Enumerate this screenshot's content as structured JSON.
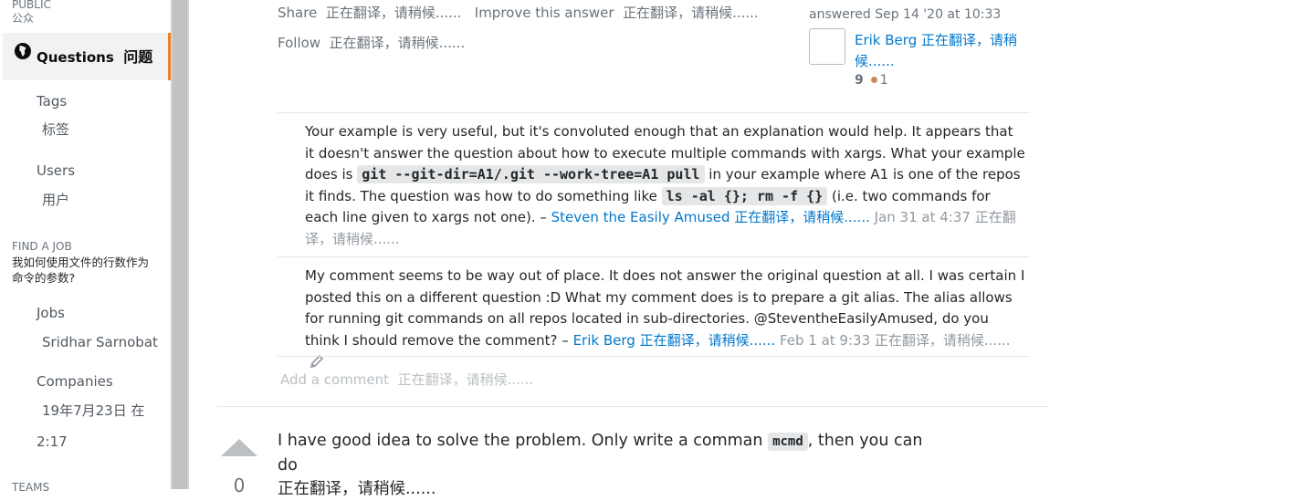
{
  "sidebar": {
    "public_heading": "PUBLIC",
    "public_heading_cn": "公众",
    "questions_label": "Questions",
    "questions_label_cn": "问题",
    "tags_label": "Tags",
    "tags_label_cn": "标签",
    "users_label": "Users",
    "users_label_cn": "用户",
    "find_job_heading": "FIND A JOB",
    "find_job_cn_line1": "我如何使用文件的行数作为",
    "find_job_cn_line2": "命令的参数?",
    "jobs_label": "Jobs",
    "jobs_sub": "Sridhar Sarnobat",
    "companies_label": "Companies",
    "companies_sub_line1": "19年7月23日 在",
    "companies_sub_line2": "2:17",
    "teams_heading": "TEAMS"
  },
  "post_menu": {
    "share": "Share",
    "share_cn": "正在翻译，请稍候......",
    "improve": "Improve this answer",
    "improve_cn": "正在翻译，请稍候......",
    "follow": "Follow",
    "follow_cn": "正在翻译，请稍候......"
  },
  "user_card": {
    "answered": "answered Sep 14 '20 at 10:33",
    "name": "Erik Berg",
    "name_cn_line1": "正在翻译，请稍",
    "name_cn_line2": "候......",
    "reputation": "9",
    "bronze_badges": "1"
  },
  "comments": [
    {
      "text_1": "Your example is very useful, but it's convoluted enough that an explanation would help. It appears that it doesn't answer the question about how to execute multiple commands with xargs. What your example does is ",
      "code_1": "git --git-dir=A1/.git --work-tree=A1 pull",
      "text_2": " in your example where A1 is one of the repos it finds. The question was how to do something like ",
      "code_2": "ls -al {}; rm -f {}",
      "text_3": " (i.e. two commands for each line given to xargs not one). – ",
      "user": "Steven the Easily Amused",
      "user_cn": "正在翻译，请稍候......",
      "date": "Jan 31 at 4:37",
      "date_cn": "正在翻译，请稍候......"
    },
    {
      "text_1": "My comment seems to be way out of place. It does not answer the original question at all. I was certain I posted this on a different question :D What my comment does is to prepare a git alias. The alias allows for running git commands on all repos located in sub-directories. @SteventheEasilyAmused, do you think I should remove the comment? – ",
      "user": "Erik Berg",
      "user_cn": "正在翻译，请稍候......",
      "date": "Feb 1 at 9:33",
      "date_cn": "正在翻译，请稍候......"
    }
  ],
  "add_comment": "Add a comment",
  "add_comment_cn": "正在翻译，请稍候......",
  "next_answer": {
    "vote_count": "0",
    "text_1": "I have good idea to solve the problem. Only write a comman ",
    "code": "mcmd",
    "text_2": ", then you can do",
    "text_cn": "正在翻译，请稍候......"
  },
  "colors": {
    "link": "#0077cc",
    "accent": "#f48024",
    "muted": "#6a737c",
    "bronze": "#c38b5f"
  }
}
